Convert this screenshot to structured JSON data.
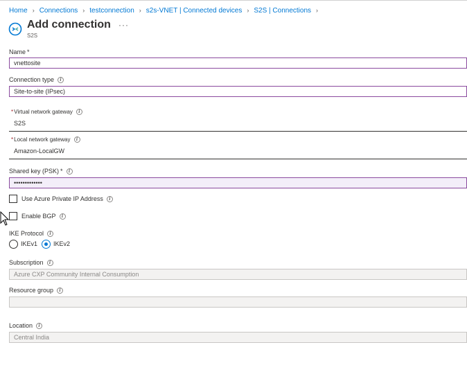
{
  "breadcrumb": [
    "Home",
    "Connections",
    "testconnection",
    "s2s-VNET | Connected devices",
    "S2S | Connections"
  ],
  "header": {
    "title": "Add connection",
    "subtitle": "S2S",
    "more_label": "···"
  },
  "form": {
    "name": {
      "label": "Name",
      "value": "vnettosite"
    },
    "connection_type": {
      "label": "Connection type",
      "value": "Site-to-site (IPsec)"
    },
    "virtual_network_gateway": {
      "label": "Virtual network gateway",
      "value": "S2S"
    },
    "local_network_gateway": {
      "label": "Local network gateway",
      "value": "Amazon-LocalGW"
    },
    "shared_key": {
      "label": "Shared key (PSK)",
      "value": "•••••••••••••"
    },
    "use_private_ip": {
      "label": "Use Azure Private IP Address",
      "checked": false
    },
    "enable_bgp": {
      "label": "Enable BGP",
      "checked": false
    },
    "ike_protocol": {
      "label": "IKE Protocol",
      "options": [
        "IKEv1",
        "IKEv2"
      ],
      "selected": "IKEv2"
    },
    "subscription": {
      "label": "Subscription",
      "value": "Azure CXP Community Internal Consumption"
    },
    "resource_group": {
      "label": "Resource group",
      "value": ""
    },
    "location": {
      "label": "Location",
      "value": "Central India"
    }
  },
  "colors": {
    "link": "#0078d4",
    "focus_border": "#8a4a9e",
    "required": "#a4262c",
    "disabled_bg": "#f3f2f1"
  }
}
